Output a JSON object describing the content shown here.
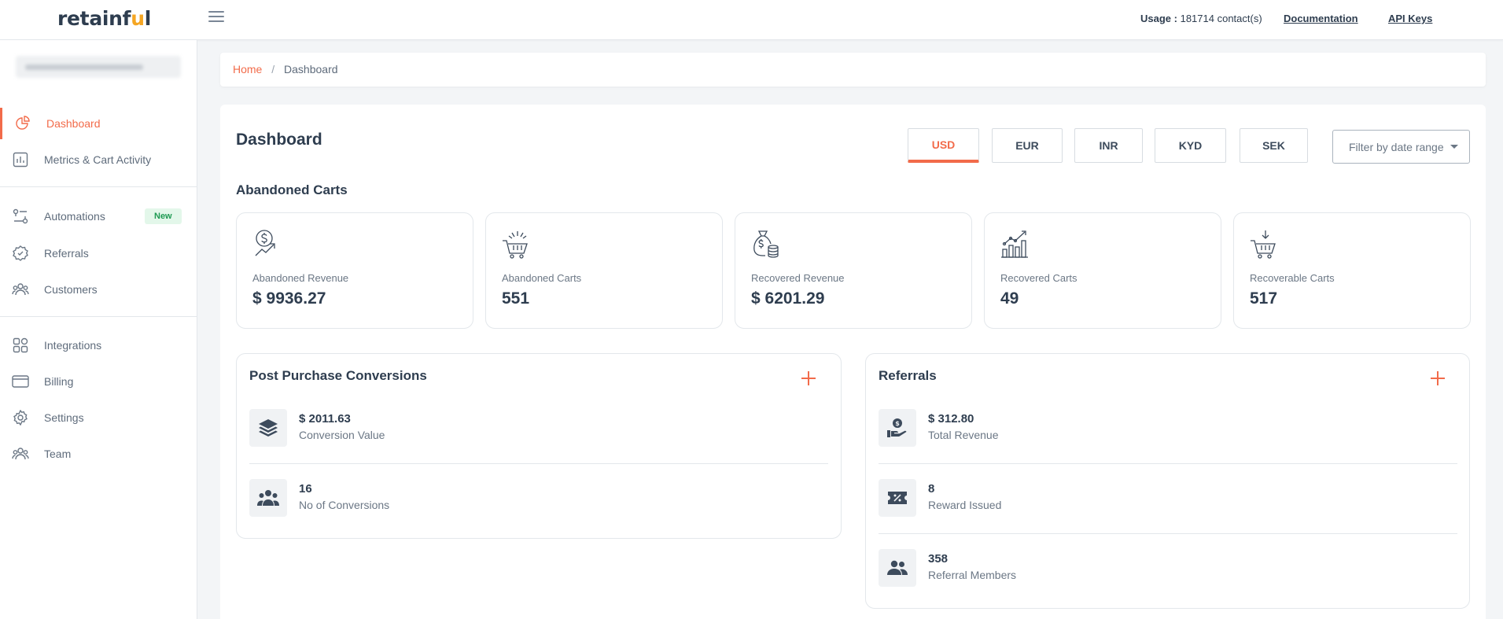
{
  "brand": {
    "name_main": "retainf",
    "name_accent": "u",
    "name_tail": "l"
  },
  "topbar": {
    "usage_label": "Usage :",
    "usage_value": "181714 contact(s)",
    "documentation": "Documentation",
    "api_keys": "API Keys"
  },
  "sidebar": {
    "items": [
      {
        "label": "Dashboard",
        "icon": "pie-chart-icon",
        "active": true
      },
      {
        "label": "Metrics & Cart Activity",
        "icon": "bar-chart-icon"
      },
      {
        "label": "Automations",
        "icon": "automations-icon",
        "badge": "New"
      },
      {
        "label": "Referrals",
        "icon": "badge-icon"
      },
      {
        "label": "Customers",
        "icon": "customers-icon"
      },
      {
        "label": "Integrations",
        "icon": "grid-icon"
      },
      {
        "label": "Billing",
        "icon": "card-icon"
      },
      {
        "label": "Settings",
        "icon": "gear-icon"
      },
      {
        "label": "Team",
        "icon": "team-icon"
      }
    ]
  },
  "breadcrumb": {
    "home": "Home",
    "separator": "/",
    "current": "Dashboard"
  },
  "main": {
    "title": "Dashboard",
    "currencies": [
      "USD",
      "EUR",
      "INR",
      "KYD",
      "SEK"
    ],
    "active_currency": "USD",
    "date_filter": "Filter by date range",
    "section_title": "Abandoned Carts",
    "stats": [
      {
        "label": "Abandoned Revenue",
        "value": "$ 9936.27",
        "icon": "dollar-trend-icon"
      },
      {
        "label": "Abandoned Carts",
        "value": "551",
        "icon": "cart-sparkle-icon"
      },
      {
        "label": "Recovered Revenue",
        "value": "$ 6201.29",
        "icon": "money-bag-icon"
      },
      {
        "label": "Recovered Carts",
        "value": "49",
        "icon": "growth-chart-icon"
      },
      {
        "label": "Recoverable Carts",
        "value": "517",
        "icon": "cart-download-icon"
      }
    ],
    "post_purchase": {
      "title": "Post Purchase Conversions",
      "rows": [
        {
          "value": "$ 2011.63",
          "label": "Conversion Value",
          "icon": "layers-icon"
        },
        {
          "value": "16",
          "label": "No of Conversions",
          "icon": "users-group-icon"
        }
      ]
    },
    "referrals": {
      "title": "Referrals",
      "rows": [
        {
          "value": "$ 312.80",
          "label": "Total Revenue",
          "icon": "hand-coin-icon"
        },
        {
          "value": "8",
          "label": "Reward Issued",
          "icon": "coupon-icon"
        },
        {
          "value": "358",
          "label": "Referral Members",
          "icon": "members-icon"
        }
      ]
    }
  },
  "colors": {
    "accent": "#f26b4a",
    "text": "#2e3d4f",
    "muted": "#6b7785",
    "new_badge_bg": "#e3f7ea",
    "new_badge_text": "#1e9a52"
  }
}
